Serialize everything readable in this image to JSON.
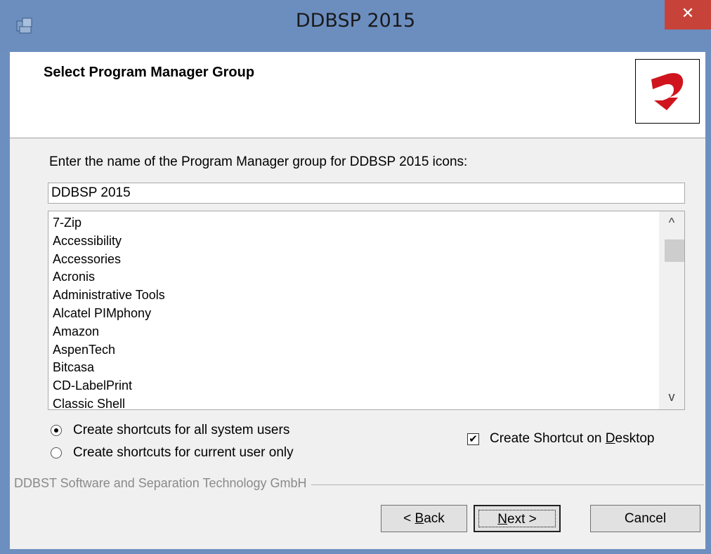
{
  "window": {
    "title": "DDBSP 2015",
    "close_label": "✕"
  },
  "header": {
    "title": "Select Program Manager Group"
  },
  "instruction": "Enter the name of the Program Manager group for DDBSP 2015 icons:",
  "group_input": {
    "value": "DDBSP 2015"
  },
  "groups": [
    "7-Zip",
    "Accessibility",
    "Accessories",
    "Acronis",
    "Administrative Tools",
    "Alcatel PIMphony",
    "Amazon",
    "AspenTech",
    "Bitcasa",
    "CD-LabelPrint",
    "Classic Shell"
  ],
  "scroll": {
    "up": "^",
    "down": "v"
  },
  "options": {
    "all_users": "Create shortcuts for all system users",
    "current_user": "Create shortcuts for current user only",
    "desktop_pre": "Create Shortcut on ",
    "desktop_key": "D",
    "desktop_post": "esktop",
    "desktop_checked_mark": "✔"
  },
  "company": "DDBST Software and Separation Technology GmbH",
  "buttons": {
    "back_pre": "< ",
    "back_key": "B",
    "back_post": "ack",
    "next_key": "N",
    "next_post": "ext >",
    "cancel": "Cancel"
  },
  "colors": {
    "titlebar": "#6b8ebf",
    "close": "#c74339",
    "logo_red": "#d0141e"
  }
}
